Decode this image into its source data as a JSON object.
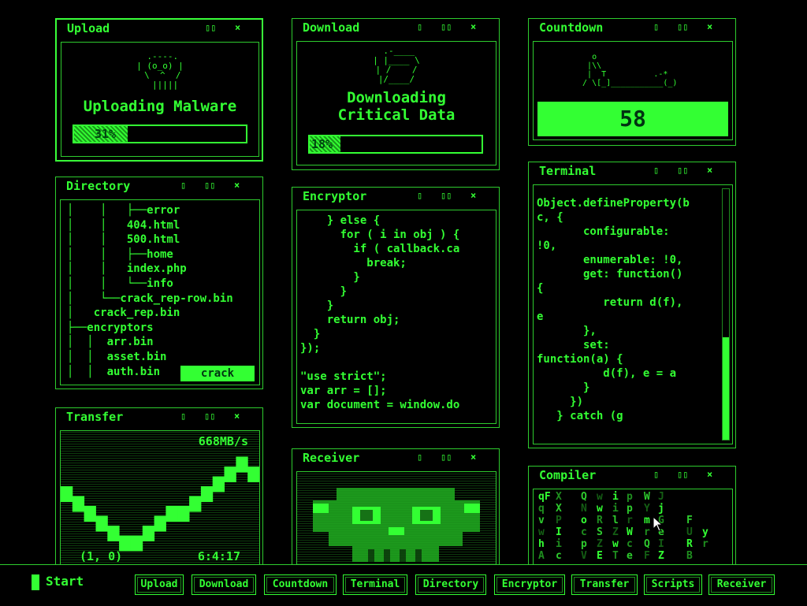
{
  "colors": {
    "accent": "#33ff33",
    "dim": "#1a9a1a",
    "background": "#000000"
  },
  "controls": {
    "minimize": "▯",
    "maximize": "▯▯",
    "close": "×"
  },
  "upload": {
    "title": "Upload",
    "art": " .----.\n| (o_o) |\n \\  ^  /\n  |||||",
    "heading": "Uploading Malware",
    "progress": 31,
    "progress_label": "31%"
  },
  "download": {
    "title": "Download",
    "art": " .-____\n| |____ \\\n| /    /\n|/____/",
    "heading_line1": "Downloading",
    "heading_line2": "Critical Data",
    "progress": 18,
    "progress_label": "18%"
  },
  "countdown": {
    "title": "Countdown",
    "art": "    o\n   |\\\\\n   |  T          .-*\n  / \\[_]___________(_)",
    "value": "58"
  },
  "directory": {
    "title": "Directory",
    "tree": [
      "│    │   ├──error",
      "│    │   404.html",
      "│    │   500.html",
      "│    │   ├──home",
      "│    │   index.php",
      "│    │   └──info",
      "│    └──crack_rep-row.bin",
      "│   crack_rep.bin",
      "├──encryptors",
      "│  │  arr.bin",
      "│  │  asset.bin",
      "│  │  auth.bin"
    ],
    "crack_label": "crack"
  },
  "encryptor": {
    "title": "Encryptor",
    "code": "    } else {\n      for ( i in obj ) {\n        if ( callback.ca\n          break;\n        }\n      }\n    }\n    return obj;\n  }\n});\n\n\"use strict\";\nvar arr = [];\nvar document = window.do"
  },
  "terminal": {
    "title": "Terminal",
    "code": "Object.defineProperty(b\nc, {\n       configurable:\n!0,\n       enumerable: !0,\n       get: function()\n{\n          return d(f),\ne\n       },\n       set:\nfunction(a) {\n          d(f), e = a\n       }\n     })\n   } catch (g"
  },
  "transfer": {
    "title": "Transfer",
    "rate": "668MB/s",
    "coords": "(1, 0)",
    "time": "6:4:17",
    "chart_data": {
      "type": "bar",
      "values": [
        6,
        5,
        4,
        3,
        2,
        1,
        1,
        2,
        3,
        4,
        4,
        5,
        6,
        7,
        8,
        9,
        8
      ],
      "ylim": [
        0,
        10
      ]
    }
  },
  "receiver": {
    "title": "Receiver"
  },
  "compiler": {
    "title": "Compiler",
    "rows": [
      "qF X Q w i p W J",
      "q  X N w i p Y j",
      "v P o R l r m G F",
      "w I c S Z W r e U y",
      "h i p Z w c Q I R r",
      "A c V E T e F Z B"
    ]
  },
  "taskbar": {
    "start_label": "Start",
    "buttons": [
      "Upload",
      "Download",
      "Countdown",
      "Terminal",
      "Directory",
      "Encryptor",
      "Transfer",
      "Scripts",
      "Receiver"
    ]
  }
}
